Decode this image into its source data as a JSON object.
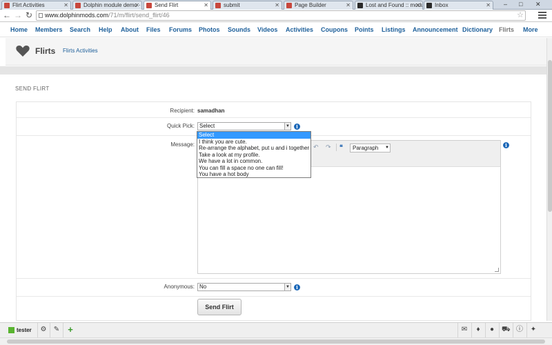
{
  "browser": {
    "tabs": [
      {
        "label": "Flirt Activities",
        "active": false
      },
      {
        "label": "Dolphin module demo ·",
        "active": false
      },
      {
        "label": "Send Flirt",
        "active": true
      },
      {
        "label": "submit",
        "active": false
      },
      {
        "label": "Page Builder",
        "active": false
      },
      {
        "label": "Lost and Found :: modu",
        "active": false
      },
      {
        "label": "Inbox",
        "active": false
      }
    ],
    "url_host": "www.dolphinmods.com",
    "url_path": "/71/m/flirt/send_flirt/46"
  },
  "nav": {
    "items": [
      "Home",
      "Members",
      "Search",
      "Help",
      "About",
      "Files",
      "Forums",
      "Photos",
      "Sounds",
      "Videos",
      "Activities",
      "Coupons",
      "Points",
      "Listings",
      "Announcement",
      "Dictionary",
      "Flirts",
      "More"
    ]
  },
  "header": {
    "title": "Flirts",
    "link": "Flirts Activities"
  },
  "form": {
    "section_title": "SEND FLIRT",
    "recipient_label": "Recipient:",
    "recipient_value": "samadhan",
    "quickpick_label": "Quick Pick:",
    "quickpick_value": "Select",
    "quickpick_options": [
      "Select",
      "I think you are cute.",
      "Re-arrange the alphabet, put u and i together",
      "Take a look at my profile.",
      "We have a lot in common.",
      "You can fill a space no one can fill!",
      "You have a hot body"
    ],
    "message_label": "Message:",
    "editor_format": "Paragraph",
    "anonymous_label": "Anonymous:",
    "anonymous_value": "No",
    "submit_label": "Send Flirt"
  },
  "bottombar": {
    "username": "tester"
  },
  "colors": {
    "link_blue": "#1d5f9a",
    "info_blue": "#1c68b8",
    "online_green": "#59b430",
    "selected_option": "#3399ff"
  }
}
